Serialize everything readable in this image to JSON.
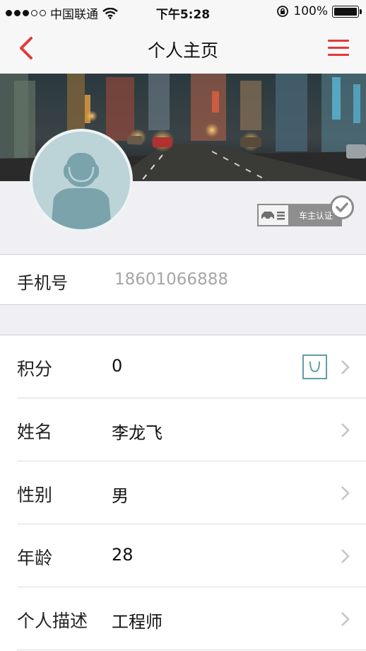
{
  "status_bar": {
    "carrier": "中国联通",
    "time": "下午5:28",
    "battery_text": "100%",
    "signal_filled": 3,
    "signal_total": 5
  },
  "nav": {
    "title": "个人主页",
    "back_icon": "chevron-left-icon",
    "menu_icon": "hamburger-menu-icon",
    "accent_color": "#e4393c"
  },
  "profile": {
    "banner": "city-night-street-photo",
    "avatar": "default-user-avatar",
    "badge_label": "车主认证"
  },
  "phone": {
    "label": "手机号",
    "value": "18601066888"
  },
  "rows": [
    {
      "label": "积分",
      "value": "0"
    },
    {
      "label": "姓名",
      "value": "李龙飞"
    },
    {
      "label": "性别",
      "value": "男"
    },
    {
      "label": "年龄",
      "value": "28"
    },
    {
      "label": "个人描述",
      "value": "工程师"
    }
  ]
}
